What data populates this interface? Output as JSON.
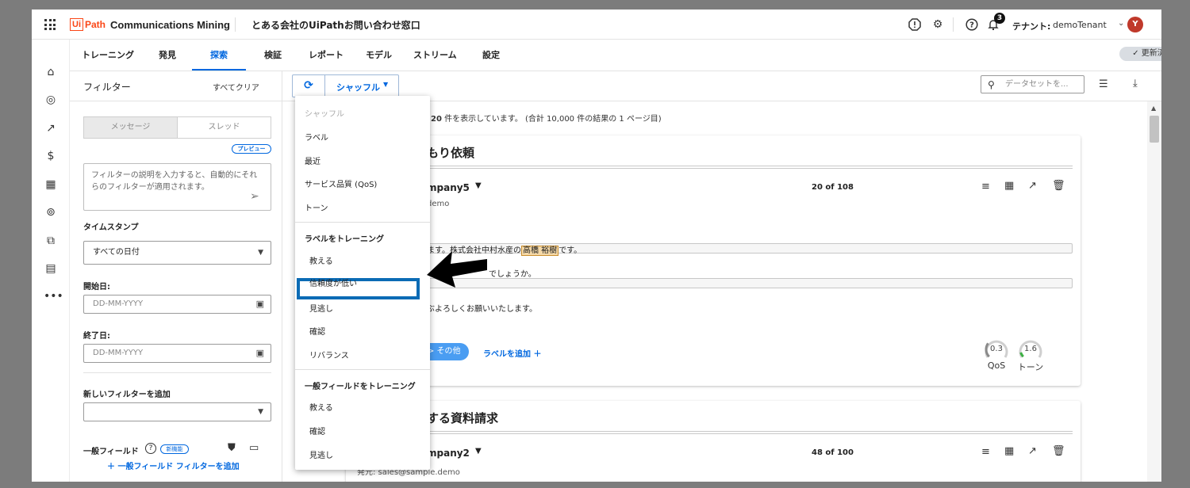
{
  "header": {
    "logo_box": "Ui",
    "logo_path": "Path",
    "product": "Communications Mining",
    "dataset_title": "とある会社のUiPathお問い合わせ窓口",
    "notification_count": "3",
    "tenant_label": "テナント:",
    "tenant_name": "demoTenant",
    "avatar_initial": "Y"
  },
  "nav": {
    "tabs": [
      "トレーニング",
      "発見",
      "探索",
      "検証",
      "レポート",
      "モデル",
      "ストリーム",
      "設定"
    ],
    "active_tab": "探索",
    "status_pill": "✓ 更新済み"
  },
  "filters": {
    "title": "フィルター",
    "clear": "すべてクリア",
    "segment_left": "メッセージ",
    "segment_right": "スレッド",
    "preview_badge": "プレビュー",
    "description_placeholder": "フィルターの説明を入力すると、自動的にそれらのフィルターが適用されます。",
    "timestamp_label": "タイムスタンプ",
    "date_range_value": "すべての日付",
    "start_label": "開始日:",
    "start_placeholder": "DD-MM-YYYY",
    "end_label": "終了日:",
    "end_placeholder": "DD-MM-YYYY",
    "new_filter_label": "新しいフィルターを追加",
    "new_filter_value": "",
    "general_fields_label": "一般フィールド",
    "general_fields_help": "?",
    "new_feature_badge": "新機能",
    "add_general_filter": "＋ 一般フィールド フィルターを追加"
  },
  "toolbar": {
    "shuffle_label": "シャッフル",
    "search_placeholder": "データセットを..."
  },
  "results": {
    "summary_count": "20",
    "summary_rest": " 件を表示しています。 (合計 10,000 件の結果の 1 ページ目)"
  },
  "cards": [
    {
      "title_visible": "もり依頼",
      "company_visible": "mpany5",
      "count": "20 of 108",
      "sender_visible": "demo",
      "line1_visible": "ます。株式会社中村水産の",
      "line1_name": "高橋 裕樹",
      "line1_tail": "です。",
      "line2_visible": "でしょうか。",
      "line3_visible": "ぶよろしくお願いいたします。",
      "label_chip": "> その他",
      "add_label": "ラベルを追加 ＋",
      "qos_value": "0.3",
      "qos_fraction": 0.3,
      "qos_label": "QoS",
      "tone_value": "1.6",
      "tone_fraction": 0.1,
      "tone_label": "トーン"
    },
    {
      "title_visible": "する資料請求",
      "company_visible": "mpany2",
      "count": "48 of 100",
      "sender_visible": "発元: sales@sample.demo"
    }
  ],
  "shuffle_menu": {
    "header": "シャッフル",
    "items_top": [
      "ラベル",
      "最近",
      "サービス品質 (QoS)",
      "トーン"
    ],
    "section_labels": "ラベルをトレーニング",
    "items_labels": [
      "教える",
      "信頼度が低い",
      "見逃し",
      "確認",
      "リバランス"
    ],
    "section_general": "一般フィールドをトレーニング",
    "items_general": [
      "教える",
      "確認",
      "見逃し"
    ],
    "highlighted_item": "信頼度が低い"
  },
  "colors": {
    "accent": "#0067df",
    "brand": "#fa4616",
    "annotation_box": "#0b6bb5",
    "chip": "#4a9df2",
    "name_highlight": "#f5d9a8"
  }
}
